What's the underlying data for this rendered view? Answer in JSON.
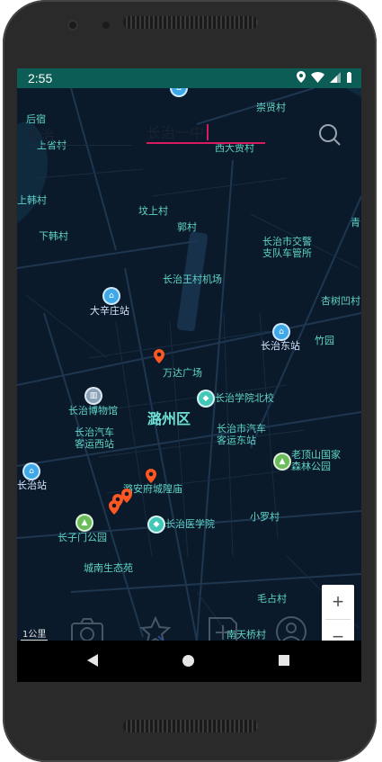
{
  "status": {
    "time": "2:55"
  },
  "search": {
    "origin_value": "长治",
    "destination_value": "长治一中"
  },
  "map": {
    "labels": {
      "houzhuang": "后宿",
      "shangshengcun": "上省村",
      "chongxiancun": "崇贤村",
      "xidazhangcun": "西大贾村",
      "shanghancun": "上韩村",
      "xiahancun": "下韩村",
      "donshangcun": "坟上村",
      "guocun": "郭村",
      "jiaojing": "长治市交警\n支队车管所",
      "qing": "青",
      "airport": "长治王村机场",
      "xingshu": "杏树凹村",
      "dashenzhuang": "大辛庄站",
      "changzhidong": "长治东站",
      "zhuyuan": "竹园",
      "wanda": "万达广场",
      "museum": "长治博物馆",
      "xueyuan_north": "长治学院北校",
      "luzhou": "潞州区",
      "bus_west": "长治汽车\n客运西站",
      "bus_east": "长治市汽车\n客运东站",
      "laodingshan": "老顶山国家\n森林公园",
      "changzhi_station": "长治站",
      "lu_an_fu": "潞安府城隍庙",
      "changzi_park": "长子门公园",
      "medical": "长治医学院",
      "xiaoluocun": "小罗村",
      "chengnan": "城南生态苑",
      "maozhan": "毛占村",
      "nantianqiao": "南天桥村",
      "scale": "1公里"
    }
  },
  "zoom": {
    "in": "+",
    "out": "−"
  },
  "colors": {
    "status_bg": "#0d5d57",
    "map_bg": "#0a1a2a",
    "label": "#5fd5c8",
    "accent": "#d81b60",
    "pin": "#ff5722"
  }
}
